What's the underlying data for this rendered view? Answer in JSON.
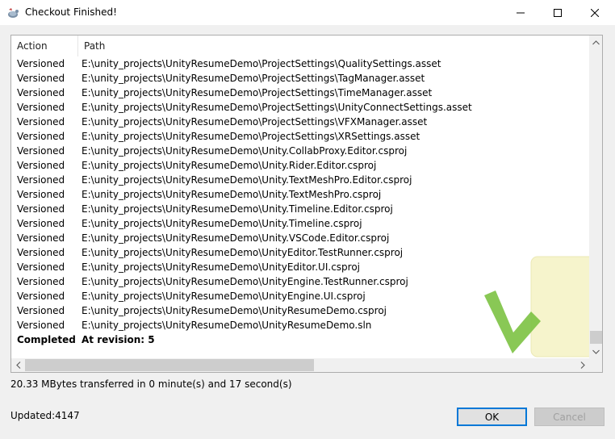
{
  "window": {
    "title": "Checkout Finished!",
    "icon": "tortoise-svn-icon"
  },
  "list": {
    "columns": [
      "Action",
      "Path"
    ],
    "rows": [
      {
        "action": "Versioned",
        "path": "E:\\unity_projects\\UnityResumeDemo\\ProjectSettings\\QualitySettings.asset"
      },
      {
        "action": "Versioned",
        "path": "E:\\unity_projects\\UnityResumeDemo\\ProjectSettings\\TagManager.asset"
      },
      {
        "action": "Versioned",
        "path": "E:\\unity_projects\\UnityResumeDemo\\ProjectSettings\\TimeManager.asset"
      },
      {
        "action": "Versioned",
        "path": "E:\\unity_projects\\UnityResumeDemo\\ProjectSettings\\UnityConnectSettings.asset"
      },
      {
        "action": "Versioned",
        "path": "E:\\unity_projects\\UnityResumeDemo\\ProjectSettings\\VFXManager.asset"
      },
      {
        "action": "Versioned",
        "path": "E:\\unity_projects\\UnityResumeDemo\\ProjectSettings\\XRSettings.asset"
      },
      {
        "action": "Versioned",
        "path": "E:\\unity_projects\\UnityResumeDemo\\Unity.CollabProxy.Editor.csproj"
      },
      {
        "action": "Versioned",
        "path": "E:\\unity_projects\\UnityResumeDemo\\Unity.Rider.Editor.csproj"
      },
      {
        "action": "Versioned",
        "path": "E:\\unity_projects\\UnityResumeDemo\\Unity.TextMeshPro.Editor.csproj"
      },
      {
        "action": "Versioned",
        "path": "E:\\unity_projects\\UnityResumeDemo\\Unity.TextMeshPro.csproj"
      },
      {
        "action": "Versioned",
        "path": "E:\\unity_projects\\UnityResumeDemo\\Unity.Timeline.Editor.csproj"
      },
      {
        "action": "Versioned",
        "path": "E:\\unity_projects\\UnityResumeDemo\\Unity.Timeline.csproj"
      },
      {
        "action": "Versioned",
        "path": "E:\\unity_projects\\UnityResumeDemo\\Unity.VSCode.Editor.csproj"
      },
      {
        "action": "Versioned",
        "path": "E:\\unity_projects\\UnityResumeDemo\\UnityEditor.TestRunner.csproj"
      },
      {
        "action": "Versioned",
        "path": "E:\\unity_projects\\UnityResumeDemo\\UnityEditor.UI.csproj"
      },
      {
        "action": "Versioned",
        "path": "E:\\unity_projects\\UnityResumeDemo\\UnityEngine.TestRunner.csproj"
      },
      {
        "action": "Versioned",
        "path": "E:\\unity_projects\\UnityResumeDemo\\UnityEngine.UI.csproj"
      },
      {
        "action": "Versioned",
        "path": "E:\\unity_projects\\UnityResumeDemo\\UnityResumeDemo.csproj"
      },
      {
        "action": "Versioned",
        "path": "E:\\unity_projects\\UnityResumeDemo\\UnityResumeDemo.sln"
      },
      {
        "action": "Completed",
        "path": "At revision: 5",
        "bold": true
      }
    ]
  },
  "status": {
    "transfer": "20.33 MBytes transferred in 0 minute(s) and 17 second(s)",
    "updated": "Updated:4147"
  },
  "buttons": {
    "ok": "OK",
    "cancel": "Cancel"
  },
  "colors": {
    "accent": "#0078d7",
    "watermark_green": "#7cc242",
    "watermark_yellow": "#f5f3c4"
  }
}
